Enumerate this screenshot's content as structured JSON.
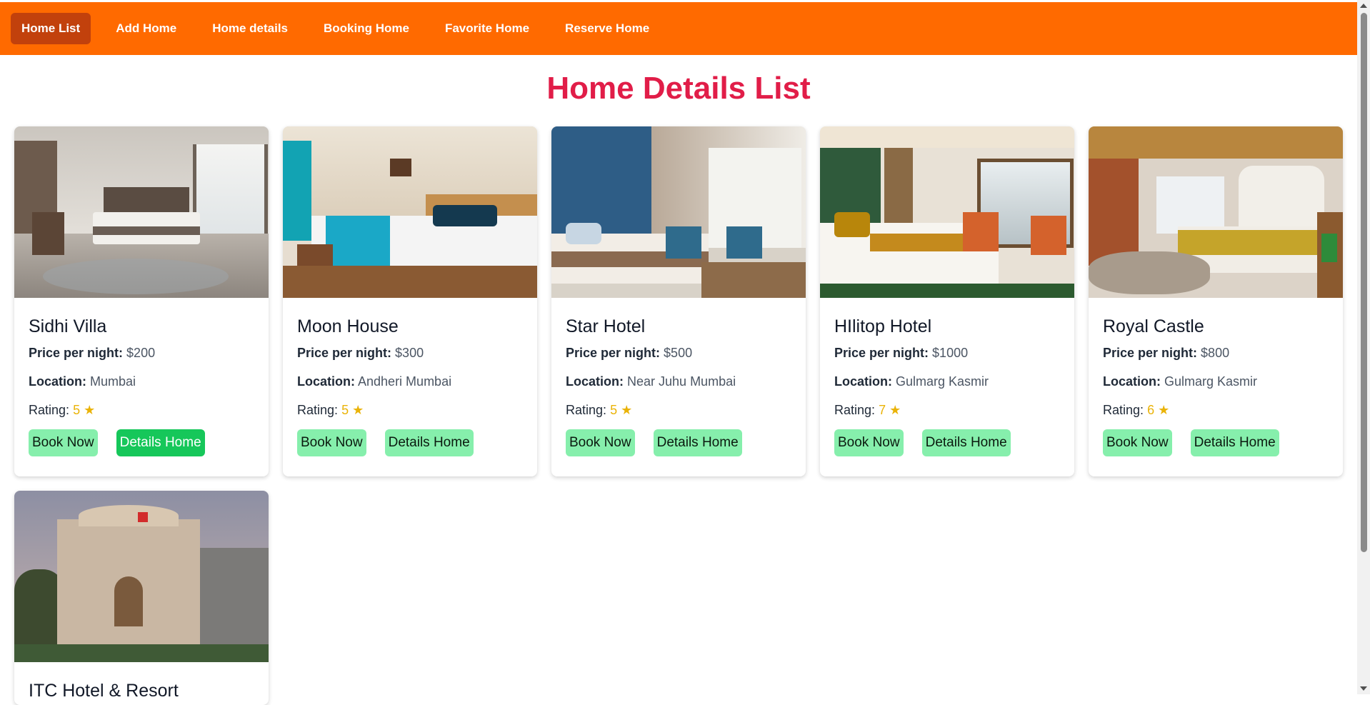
{
  "nav": {
    "items": [
      "Home List",
      "Add Home",
      "Home details",
      "Booking Home",
      "Favorite Home",
      "Reserve Home"
    ],
    "active_index": 0
  },
  "page": {
    "title": "Home Details List"
  },
  "labels": {
    "price": "Price per night:",
    "location": "Location:",
    "rating": "Rating:",
    "book": "Book Now",
    "details": "Details Home",
    "star": "★"
  },
  "homes": [
    {
      "name": "Sidhi Villa",
      "price": "$200",
      "location": "Mumbai",
      "rating": "5"
    },
    {
      "name": "Moon House",
      "price": "$300",
      "location": "Andheri Mumbai",
      "rating": "5"
    },
    {
      "name": "Star Hotel",
      "price": "$500",
      "location": "Near Juhu Mumbai",
      "rating": "5"
    },
    {
      "name": "HIlitop Hotel",
      "price": "$1000",
      "location": "Gulmarg Kasmir",
      "rating": "7"
    },
    {
      "name": "Royal Castle",
      "price": "$800",
      "location": "Gulmarg Kasmir",
      "rating": "6"
    },
    {
      "name": "ITC Hotel & Resort"
    }
  ],
  "colors": {
    "navbar": "#ff6a00",
    "nav_active": "#c2410c",
    "title": "#e11d48",
    "button_light": "#86efac",
    "button_strong": "#16c75a",
    "star": "#eab308"
  }
}
